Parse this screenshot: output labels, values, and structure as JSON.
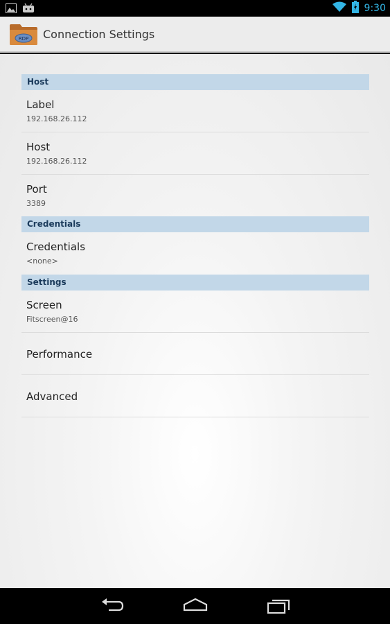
{
  "status_bar": {
    "time": "9:30",
    "left_icons": [
      "picture-icon",
      "android-icon"
    ],
    "right_icons": [
      "wifi-icon",
      "battery-icon"
    ],
    "time_color": "#33b5e5"
  },
  "action_bar": {
    "app_icon": "rdp-folder-icon",
    "app_icon_text": "RDP",
    "title": "Connection Settings"
  },
  "sections": {
    "host": {
      "header": "Host",
      "label": {
        "title": "Label",
        "summary": "192.168.26.112"
      },
      "host": {
        "title": "Host",
        "summary": "192.168.26.112"
      },
      "port": {
        "title": "Port",
        "summary": "3389"
      }
    },
    "credentials": {
      "header": "Credentials",
      "credentials": {
        "title": "Credentials",
        "summary": "<none>"
      }
    },
    "settings": {
      "header": "Settings",
      "screen": {
        "title": "Screen",
        "summary": "Fitscreen@16"
      },
      "performance": {
        "title": "Performance"
      },
      "advanced": {
        "title": "Advanced"
      }
    }
  },
  "nav_bar": {
    "buttons": [
      "back-icon",
      "home-icon",
      "recent-apps-icon"
    ]
  },
  "colors": {
    "section_header_bg": "#c2d7e8",
    "section_header_text": "#1b3b5c",
    "accent": "#33b5e5"
  }
}
